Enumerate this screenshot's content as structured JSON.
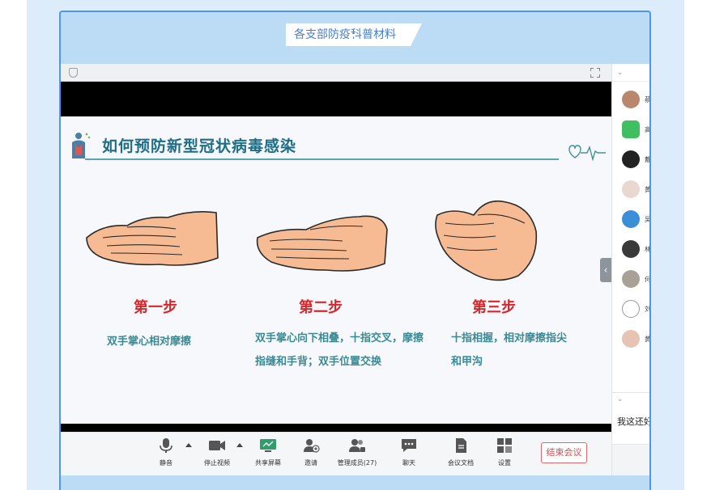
{
  "card": {
    "title": "各支部防疫科普材料"
  },
  "slide": {
    "title": "如何预防新型冠状病毒感染",
    "steps": [
      {
        "label": "第一步",
        "desc_lines": [
          "双手掌心相对摩擦"
        ]
      },
      {
        "label": "第二步",
        "desc_lines": [
          "双手掌心向下相叠，十指交叉，摩擦",
          "指缝和手背；双手位置交换"
        ]
      },
      {
        "label": "第三步",
        "desc_lines": [
          "十指相握，相对摩擦指尖",
          "和甲沟"
        ]
      }
    ]
  },
  "toolbar": {
    "mute": "静音",
    "stop_video": "停止视频",
    "share": "共享屏幕",
    "invite": "邀请",
    "manage": "管理成员(27)",
    "chat": "聊天",
    "docs": "会议文档",
    "settings": "设置",
    "end": "结束会议"
  },
  "panel": {
    "participant_labels": [
      "蔡",
      "高",
      "戴",
      "黄",
      "吴",
      "林",
      "何",
      "刘",
      "黄"
    ],
    "chat_message": "我这还好"
  },
  "colors": {
    "accent": "#4f97ea",
    "step_red": "#d8262b",
    "desc_teal": "#3b8a93",
    "title_teal": "#1e6d86"
  },
  "icons": [
    "shield-icon",
    "fullscreen-icon",
    "mic-icon",
    "video-icon",
    "share-screen-icon",
    "add-user-icon",
    "manage-members-icon",
    "chat-icon",
    "document-icon",
    "settings-icon",
    "collapse-panel-icon",
    "chevron-down-icon"
  ]
}
